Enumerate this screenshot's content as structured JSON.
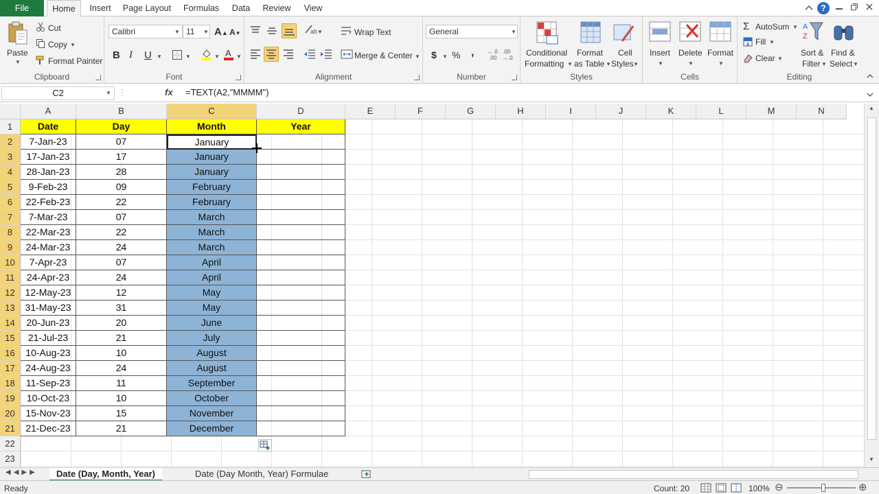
{
  "tabs": [
    "File",
    "Home",
    "Insert",
    "Page Layout",
    "Formulas",
    "Data",
    "Review",
    "View"
  ],
  "clipboard": {
    "paste": "Paste",
    "cut": "Cut",
    "copy": "Copy",
    "format_painter": "Format Painter",
    "label": "Clipboard"
  },
  "font": {
    "name": "Calibri",
    "size": "11",
    "bold": "B",
    "italic": "I",
    "underline": "U",
    "label": "Font"
  },
  "alignment": {
    "wrap_text": "Wrap Text",
    "merge_center": "Merge & Center",
    "label": "Alignment"
  },
  "number": {
    "format": "General",
    "currency": "$",
    "percent": "%",
    "comma": ",",
    "label": "Number"
  },
  "styles": {
    "conditional": "Conditional",
    "formatting": "Formatting",
    "format": "Format",
    "as_table": "as Table",
    "cell": "Cell",
    "cell_styles": "Styles",
    "label": "Styles"
  },
  "cells": {
    "insert": "Insert",
    "delete": "Delete",
    "format": "Format",
    "label": "Cells"
  },
  "editing": {
    "autosum": "AutoSum",
    "fill": "Fill",
    "clear": "Clear",
    "sort": "Sort &",
    "filter": "Filter",
    "find": "Find &",
    "select": "Select",
    "label": "Editing"
  },
  "formula_bar": {
    "name_box": "C2",
    "fx": "fx",
    "formula": "=TEXT(A2,\"MMMM\")"
  },
  "columns": [
    "A",
    "B",
    "C",
    "D",
    "E",
    "F",
    "G",
    "H",
    "I",
    "J",
    "K",
    "L",
    "M",
    "N"
  ],
  "headers": {
    "a": "Date",
    "b": "Day",
    "c": "Month",
    "d": "Year"
  },
  "rows": [
    {
      "n": "2",
      "date": "7-Jan-23",
      "day": "07",
      "month": "January"
    },
    {
      "n": "3",
      "date": "17-Jan-23",
      "day": "17",
      "month": "January"
    },
    {
      "n": "4",
      "date": "28-Jan-23",
      "day": "28",
      "month": "January"
    },
    {
      "n": "5",
      "date": "9-Feb-23",
      "day": "09",
      "month": "February"
    },
    {
      "n": "6",
      "date": "22-Feb-23",
      "day": "22",
      "month": "February"
    },
    {
      "n": "7",
      "date": "7-Mar-23",
      "day": "07",
      "month": "March"
    },
    {
      "n": "8",
      "date": "22-Mar-23",
      "day": "22",
      "month": "March"
    },
    {
      "n": "9",
      "date": "24-Mar-23",
      "day": "24",
      "month": "March"
    },
    {
      "n": "10",
      "date": "7-Apr-23",
      "day": "07",
      "month": "April"
    },
    {
      "n": "11",
      "date": "24-Apr-23",
      "day": "24",
      "month": "April"
    },
    {
      "n": "12",
      "date": "12-May-23",
      "day": "12",
      "month": "May"
    },
    {
      "n": "13",
      "date": "31-May-23",
      "day": "31",
      "month": "May"
    },
    {
      "n": "14",
      "date": "20-Jun-23",
      "day": "20",
      "month": "June"
    },
    {
      "n": "15",
      "date": "21-Jul-23",
      "day": "21",
      "month": "July"
    },
    {
      "n": "16",
      "date": "10-Aug-23",
      "day": "10",
      "month": "August"
    },
    {
      "n": "17",
      "date": "24-Aug-23",
      "day": "24",
      "month": "August"
    },
    {
      "n": "18",
      "date": "11-Sep-23",
      "day": "11",
      "month": "September"
    },
    {
      "n": "19",
      "date": "10-Oct-23",
      "day": "10",
      "month": "October"
    },
    {
      "n": "20",
      "date": "15-Nov-23",
      "day": "15",
      "month": "November"
    },
    {
      "n": "21",
      "date": "21-Dec-23",
      "day": "21",
      "month": "December"
    }
  ],
  "row_numbers": [
    "1",
    "22",
    "23"
  ],
  "sheets": [
    "Date (Day, Month, Year)",
    "Date (Day Month, Year) Formulae"
  ],
  "status": {
    "ready": "Ready",
    "count": "Count: 20",
    "zoom": "100%"
  },
  "colors": {
    "excel_green": "#1f7a3e",
    "header_yellow": "#ffff00",
    "selection_blue": "#8db4d6",
    "selected_header": "#f3d378"
  }
}
